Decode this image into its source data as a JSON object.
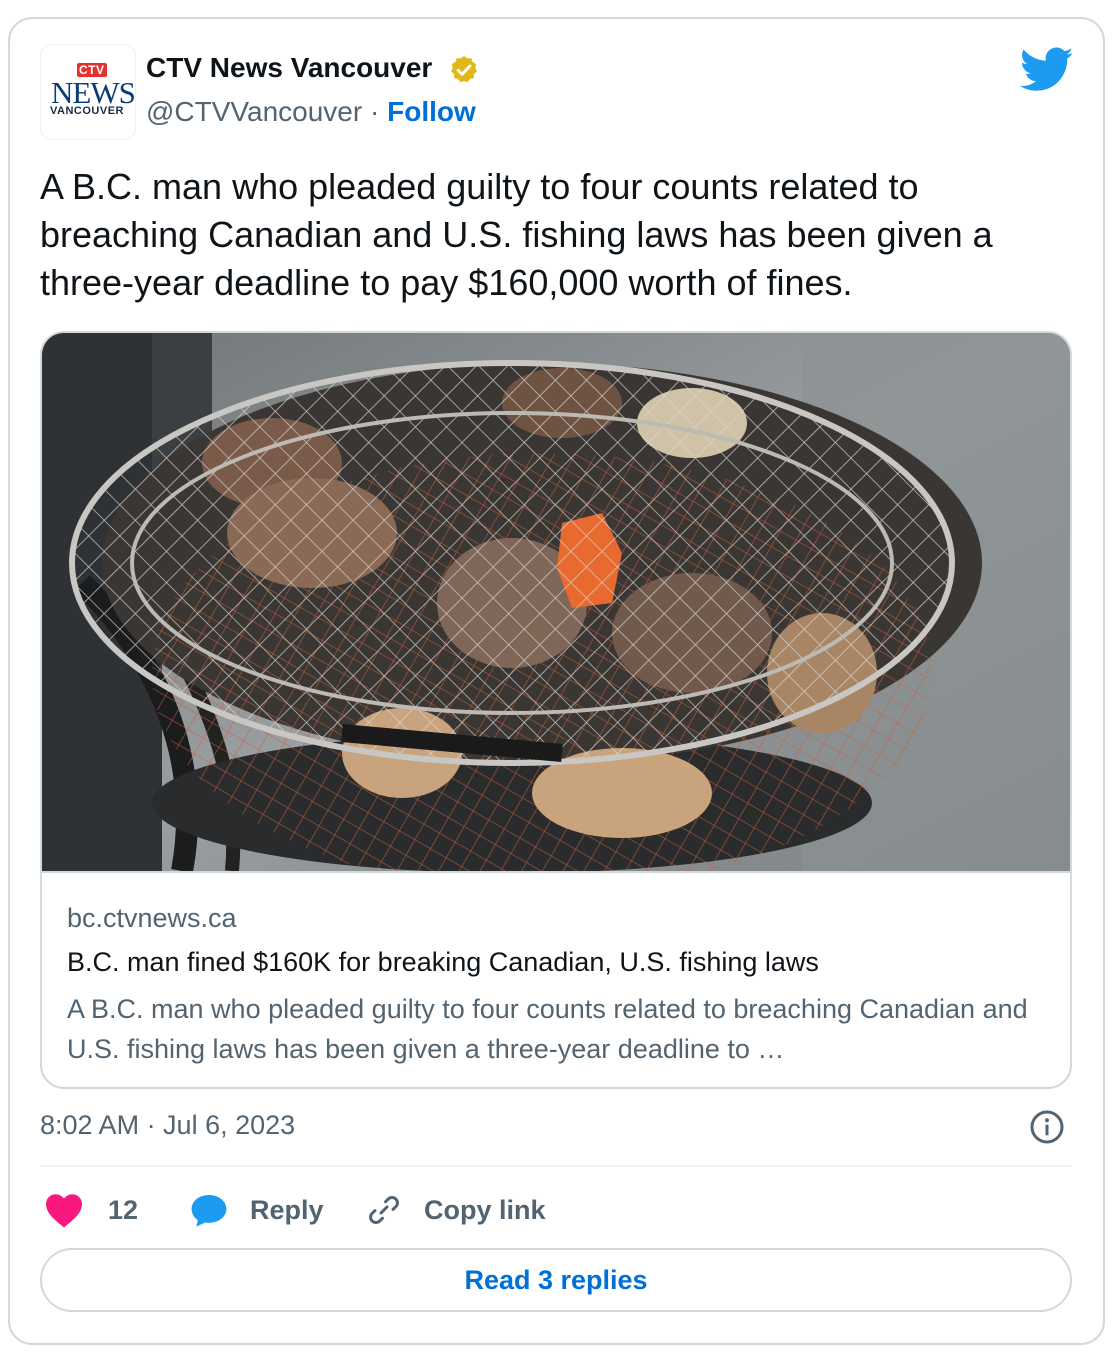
{
  "author": {
    "name": "CTV News Vancouver",
    "handle": "@CTVVancouver",
    "separator": " · ",
    "follow_label": "Follow",
    "logo": {
      "top": "CTV",
      "middle": "NEWS",
      "bottom": "VANCOUVER"
    },
    "verified_icon": "verified-badge-icon",
    "verified_color": "#e2b719"
  },
  "brand_icon": "twitter-bird-icon",
  "tweet": {
    "text": "A B.C. man who pleaded guilty to four counts related to breaching Canadian and U.S. fishing laws has been given a three-year deadline to pay $160,000 worth of fines."
  },
  "link_card": {
    "domain": "bc.ctvnews.ca",
    "title": "B.C. man fined $160K for breaking Canadian, U.S. fishing laws",
    "description": "A B.C. man who pleaded guilty to four counts related to breaching Canadian and U.S. fishing laws has been given a three-year deadline to …"
  },
  "meta": {
    "timestamp": "8:02 AM · Jul 6, 2023",
    "info_icon": "info-icon"
  },
  "actions": {
    "likes_count": "12",
    "reply_label": "Reply",
    "copy_link_label": "Copy link"
  },
  "read_replies_label": "Read 3 replies",
  "colors": {
    "accent": "#006fd6",
    "twitter_blue": "#1d9bf0",
    "like_red": "#f91880",
    "secondary_text": "#536471",
    "border": "#cfd9de"
  }
}
